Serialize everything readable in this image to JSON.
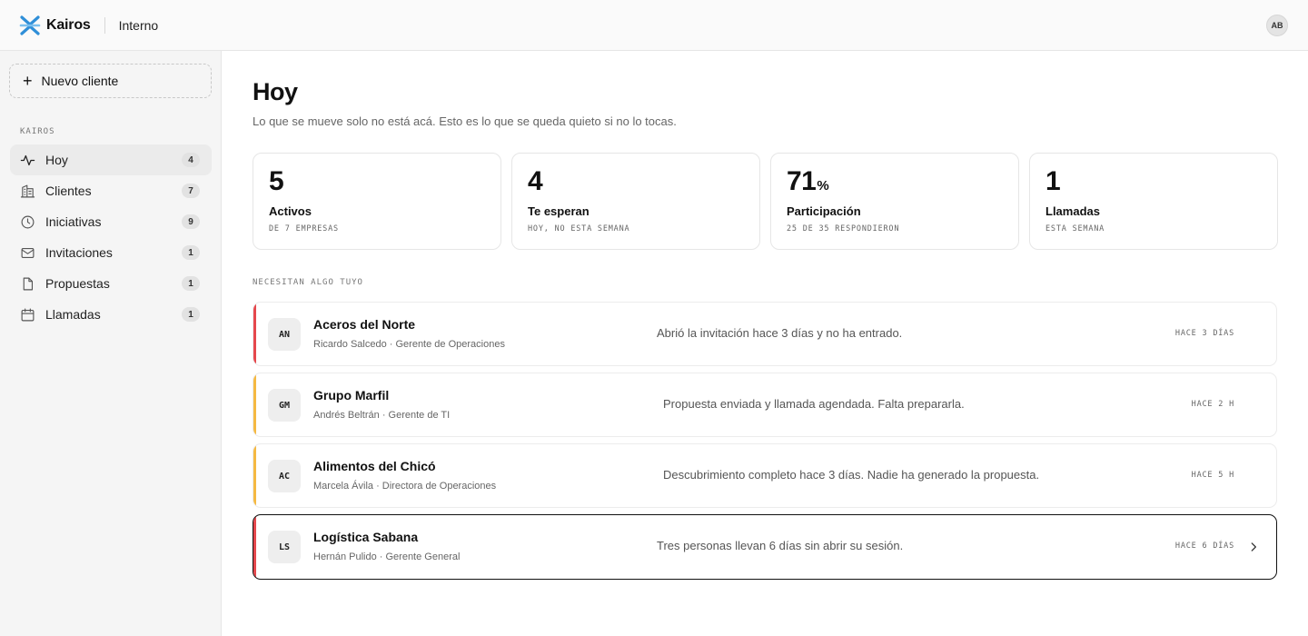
{
  "topbar": {
    "brand_name": "Kairos",
    "workspace": "Interno",
    "avatar_initials": "AB",
    "brand_color": "#2f8fd8"
  },
  "sidebar": {
    "new_client_label": "Nuevo cliente",
    "section_label": "KAIROS",
    "items": [
      {
        "label": "Hoy",
        "count": "4",
        "icon": "activity-icon",
        "active": true
      },
      {
        "label": "Clientes",
        "count": "7",
        "icon": "building-icon",
        "active": false
      },
      {
        "label": "Iniciativas",
        "count": "9",
        "icon": "clock-icon",
        "active": false
      },
      {
        "label": "Invitaciones",
        "count": "1",
        "icon": "mail-icon",
        "active": false
      },
      {
        "label": "Propuestas",
        "count": "1",
        "icon": "document-icon",
        "active": false
      },
      {
        "label": "Llamadas",
        "count": "1",
        "icon": "calendar-icon",
        "active": false
      }
    ]
  },
  "main": {
    "title": "Hoy",
    "subtitle": "Lo que se mueve solo no está acá. Esto es lo que se queda quieto si no lo tocas.",
    "stats": [
      {
        "value": "5",
        "unit": "",
        "label": "Activos",
        "note": "DE 7 EMPRESAS"
      },
      {
        "value": "4",
        "unit": "",
        "label": "Te esperan",
        "note": "HOY, NO ESTA SEMANA"
      },
      {
        "value": "71",
        "unit": "%",
        "label": "Participación",
        "note": "25 DE 35 RESPONDIERON"
      },
      {
        "value": "1",
        "unit": "",
        "label": "Llamadas",
        "note": "ESTA SEMANA"
      }
    ],
    "list_label": "NECESITAN ALGO TUYO",
    "rows": [
      {
        "initials": "AN",
        "name": "Aceros del Norte",
        "person": "Ricardo Salcedo · Gerente de Operaciones",
        "message": "Abrió la invitación hace 3 días y no ha entrado.",
        "time": "HACE 3 DÍAS",
        "status_color": "#e5484d",
        "selected": false
      },
      {
        "initials": "GM",
        "name": "Grupo Marfil",
        "person": "Andrés Beltrán · Gerente de TI",
        "message": "Propuesta enviada y llamada agendada. Falta prepararla.",
        "time": "HACE 2 H",
        "status_color": "#f5b942",
        "selected": false
      },
      {
        "initials": "AC",
        "name": "Alimentos del Chicó",
        "person": "Marcela Ávila · Directora de Operaciones",
        "message": "Descubrimiento completo hace 3 días. Nadie ha generado la propuesta.",
        "time": "HACE 5 H",
        "status_color": "#f5b942",
        "selected": false
      },
      {
        "initials": "LS",
        "name": "Logística Sabana",
        "person": "Hernán Pulido · Gerente General",
        "message": "Tres personas llevan 6 días sin abrir su sesión.",
        "time": "HACE 6 DÍAS",
        "status_color": "#e5484d",
        "selected": true
      }
    ]
  }
}
